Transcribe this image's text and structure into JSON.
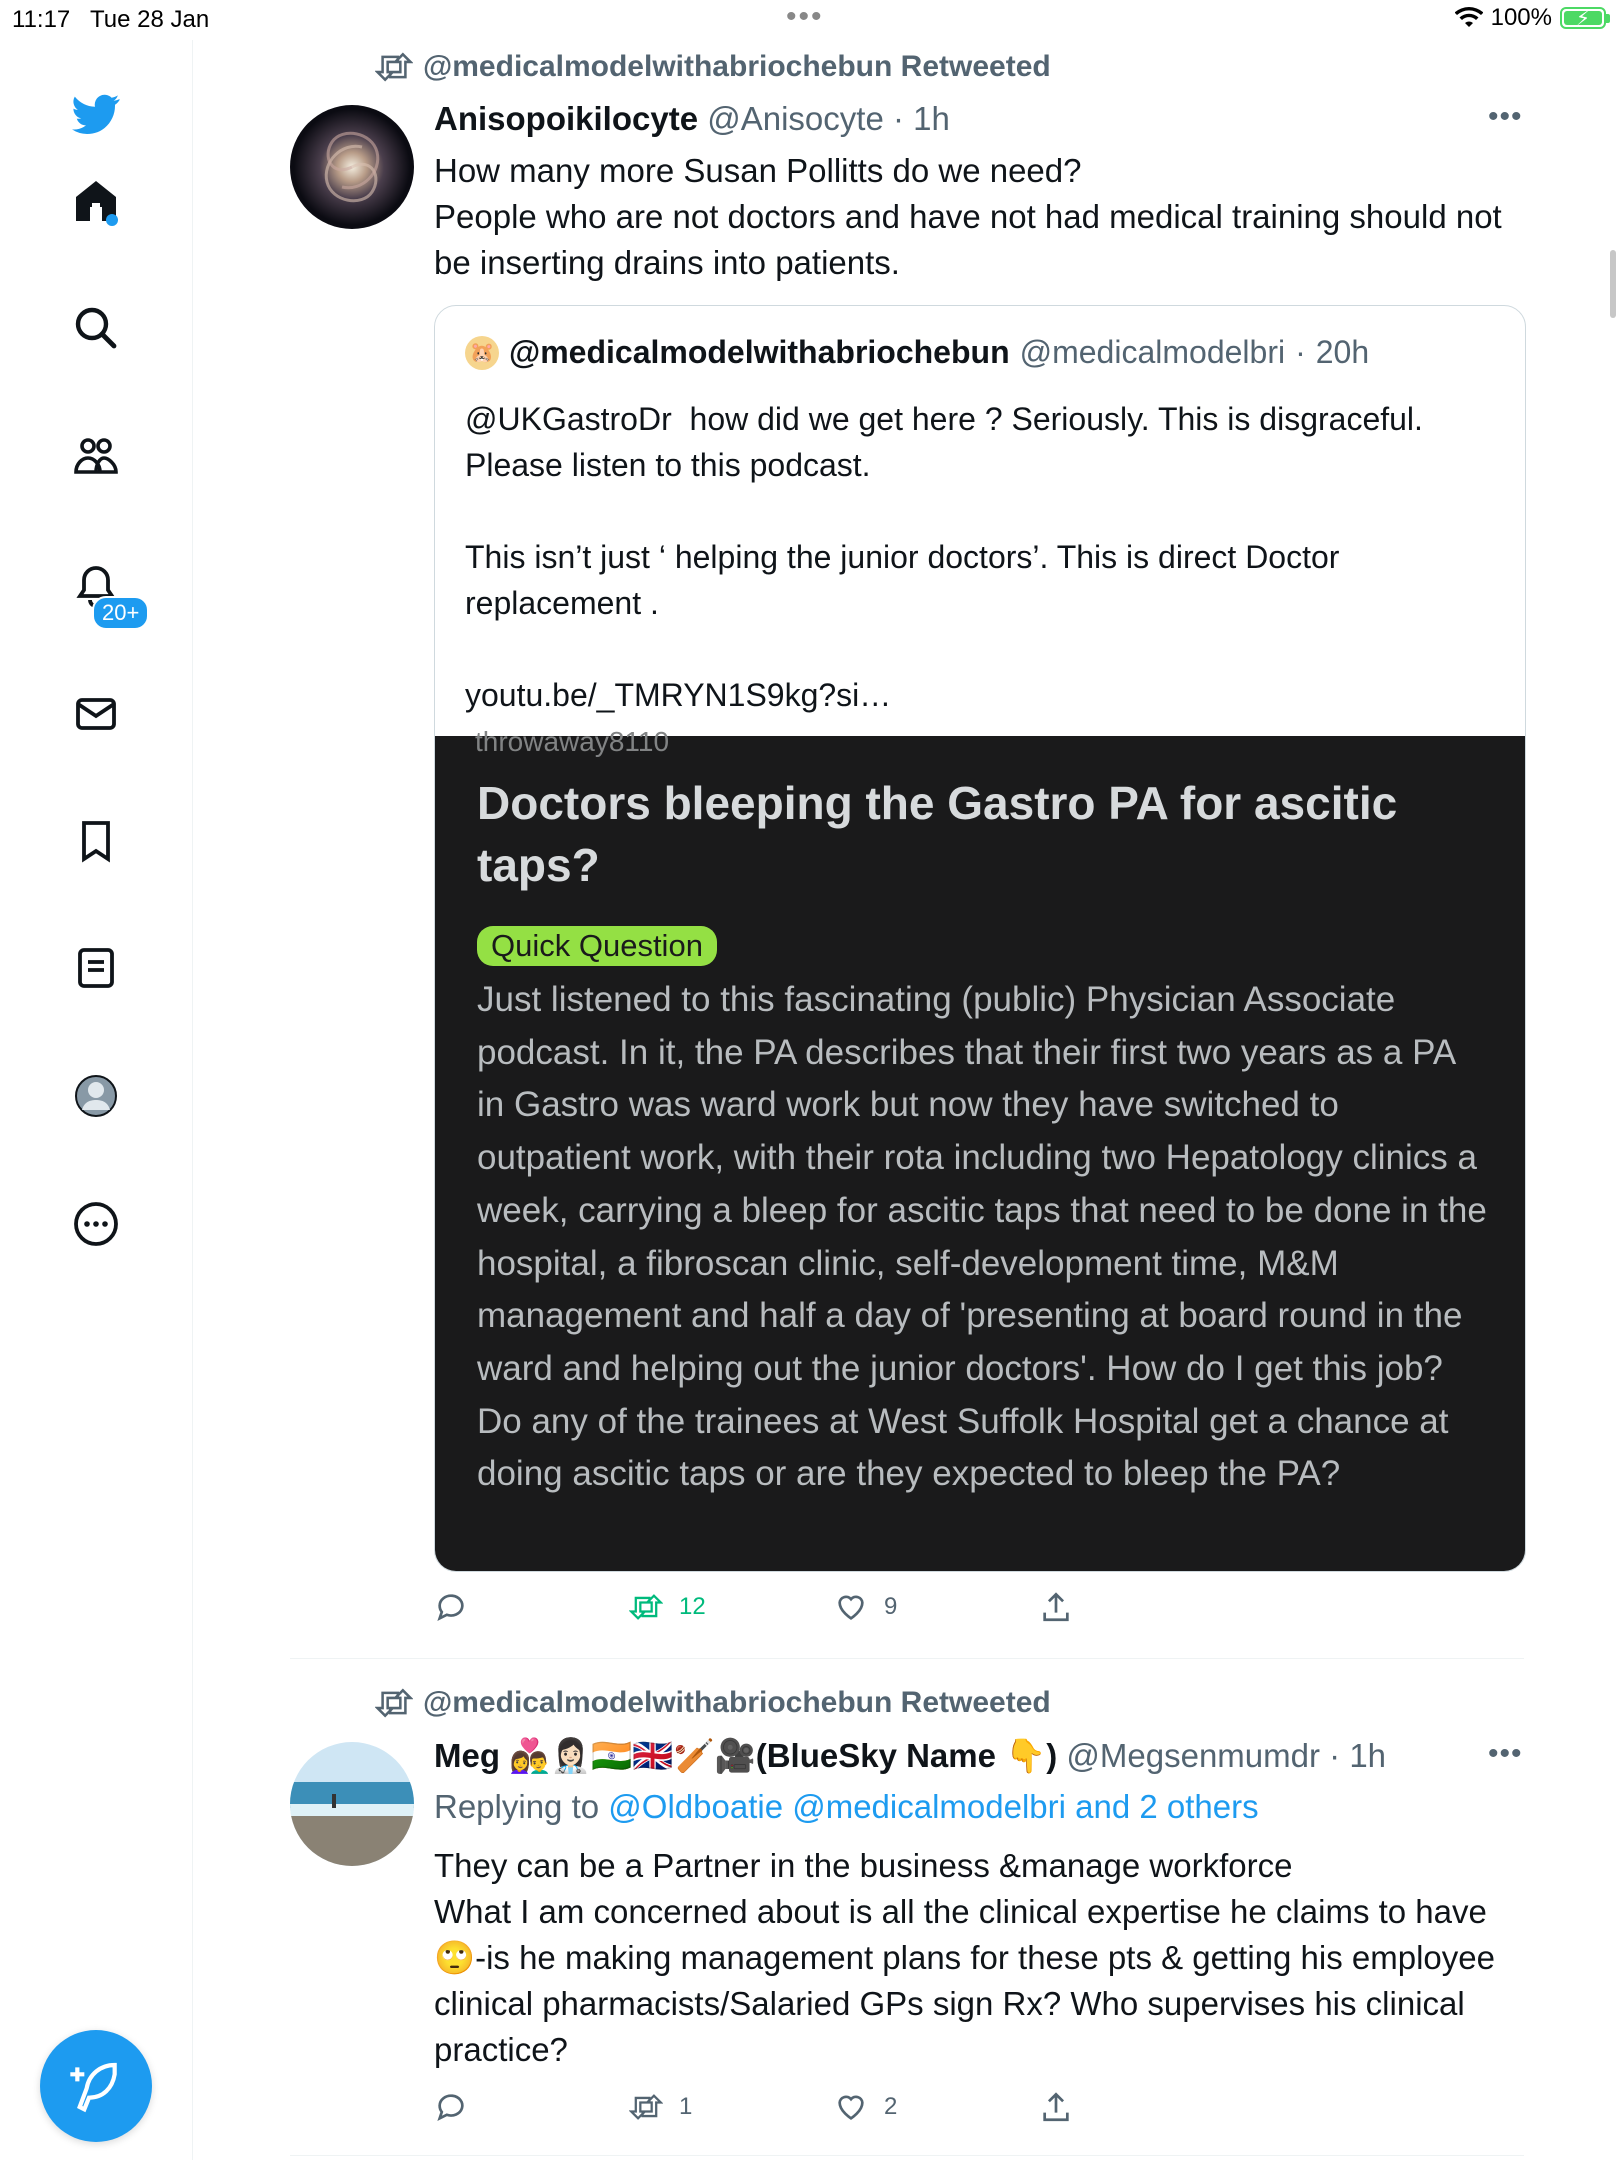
{
  "status_bar": {
    "time": "11:17",
    "date": "Tue 28 Jan",
    "dots": "•••",
    "battery": "100%"
  },
  "sidebar": {
    "notifications_badge": "20+"
  },
  "tweet1": {
    "retweeted_by": "@medicalmodelwithabriochebun Retweeted",
    "name": "Anisopoikilocyte",
    "handle": "@Anisocyte",
    "time": "1h",
    "text": "How many more Susan Pollitts do we need?\nPeople who are not doctors and have not had medical training should not be inserting drains into patients.",
    "quote": {
      "name": "@medicalmodelwithabriochebun",
      "handle": "@medicalmodelbri",
      "time": "20h",
      "text": "@UKGastroDr  how did we get here ? Seriously. This is disgraceful. Please listen to this podcast.\n\nThis isn’t just ‘ helping the junior doctors’. This is direct Doctor replacement .\n\nyoutu.be/_TMRYN1S9kg?si…",
      "image": {
        "cut_text": "throwaway8110",
        "title": "Doctors bleeping the Gastro PA for ascitic taps?",
        "flair": "Quick Question",
        "body": "Just listened to this fascinating (public) Physician Associate podcast. In it, the PA describes that their first two years as a PA in Gastro was ward work but now they have switched to outpatient work, with their rota including two Hepatology clinics a week, carrying a bleep for ascitic taps that need to be done in the hospital, a fibroscan clinic, self-development time, M&M management and half a day of 'presenting at board round in the ward and helping out the junior doctors'. How do I get this job? Do any of the trainees at West Suffolk Hospital get a chance at doing ascitic taps or are they expected to bleep the PA?"
      }
    },
    "actions": {
      "replies": "",
      "retweets": "12",
      "likes": "9"
    }
  },
  "tweet2": {
    "retweeted_by": "@medicalmodelwithabriochebun Retweeted",
    "name": "Meg 👩‍❤️‍👨👩🏻‍⚕️🇮🇳🇬🇧🏏🎥(BlueSky Name 👇)",
    "handle": "@Megsenmumdr",
    "time": "1h",
    "replying_prefix": "Replying to",
    "replying_to": "@Oldboatie @medicalmodelbri and 2 others",
    "text": "They can be a Partner in the business &manage workforce\nWhat I am concerned about is all the clinical expertise he claims to have 🙄-is he making management plans for these pts & getting his employee clinical pharmacists/Salaried GPs sign Rx? Who supervises his clinical practice?",
    "actions": {
      "replies": "",
      "retweets": "1",
      "likes": "2"
    }
  },
  "colors": {
    "accent": "#1d9bf0",
    "retweet_green": "#00ba7c",
    "flair_green": "#94e044"
  }
}
